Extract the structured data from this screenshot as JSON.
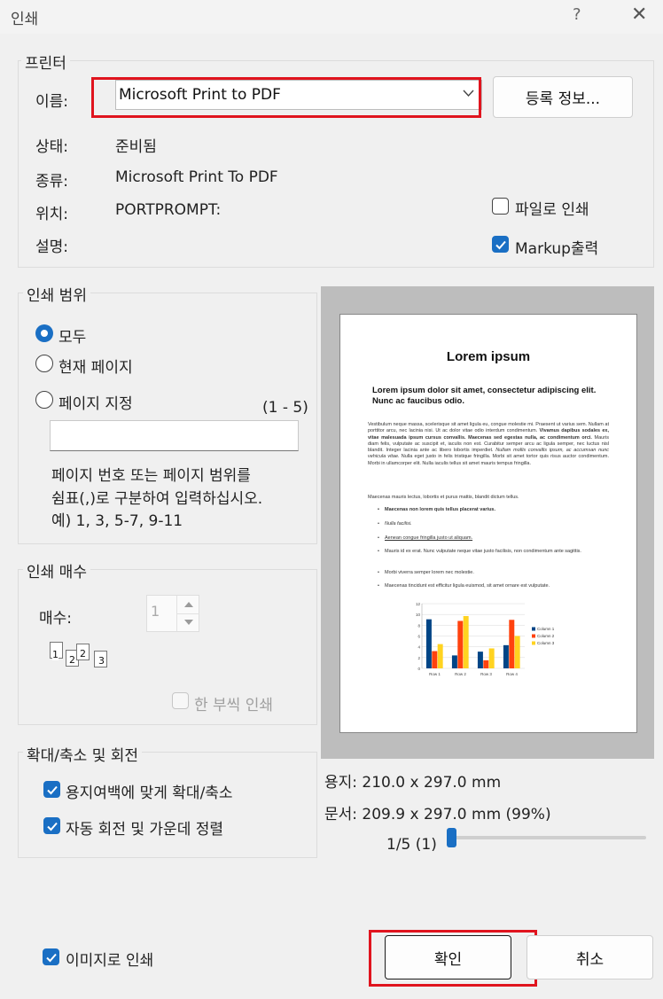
{
  "window": {
    "title": "인쇄",
    "help": "?",
    "close": "✕"
  },
  "printer": {
    "group_title": "프린터",
    "name_label": "이름:",
    "name_value": "Microsoft Print to PDF",
    "properties_button": "등록 정보...",
    "status_label": "상태:",
    "status_value": "준비됨",
    "type_label": "종류:",
    "type_value": "Microsoft Print To PDF",
    "where_label": "위치:",
    "where_value": "PORTPROMPT:",
    "comment_label": "설명:",
    "print_to_file": {
      "label": "파일로 인쇄",
      "checked": false
    },
    "markup_output": {
      "label": "Markup출력",
      "checked": true
    }
  },
  "range": {
    "group_title": "인쇄 범위",
    "options": [
      {
        "label": "모두",
        "selected": true
      },
      {
        "label": "현재 페이지",
        "selected": false
      },
      {
        "label": "페이지 지정",
        "selected": false
      }
    ],
    "page_count_hint": "(1 - 5)",
    "pages_input_value": "",
    "help_lines": [
      "페이지 번호 또는 페이지 범위를",
      "쉼표(,)로 구분하여 입력하십시오.",
      "예) 1, 3, 5-7, 9-11"
    ]
  },
  "copies": {
    "group_title": "인쇄 매수",
    "count_label": "매수:",
    "count_value": "1",
    "collate_digits": [
      "1",
      "2",
      "2",
      "3"
    ],
    "collate": {
      "label": "한 부씩 인쇄",
      "checked": false,
      "disabled": true
    }
  },
  "scaling": {
    "group_title": "확대/축소 및 회전",
    "fit_to_margins": {
      "label": "용지여백에 맞게 확대/축소",
      "checked": true
    },
    "auto_rotate_center": {
      "label": "자동 회전 및 가운데 정렬",
      "checked": true
    }
  },
  "preview": {
    "paper_size": "용지: 210.0 x 297.0 mm",
    "document_size": "문서: 209.9 x 297.0 mm (99%)",
    "page_indicator": "1/5 (1)",
    "slider_position": 0,
    "document": {
      "title": "Lorem ipsum",
      "subtitle": "Lorem ipsum dolor sit amet, consectetur adipiscing elit. Nunc ac faucibus odio.",
      "para1_a": "Vestibulum neque massa, scelerisque sit amet ligula eu, congue molestie mi. Praesent ut varius sem. Nullam at porttitor arcu, nec lacinia nisi. Ut ac dolor vitae odio interdum condimentum. ",
      "para1_b": "Vivamus dapibus sodales ex, vitae malesuada ipsum cursus convallis. Maecenas sed egestas nulla, ac condimentum orci.",
      "para1_c": " Mauris diam felis, vulputate ac suscipit et, iaculis non est. Curabitur semper arcu ac ligula semper, nec luctus nisl blandit. Integer lacinia ante ac libero lobortis imperdiet. ",
      "para1_d": "Nullam mollis convallis ipsum, ac accumsan nunc vehicula vitae.",
      "para1_e": " Nulla eget justo in felis tristique fringilla. Morbi sit amet tortor quis risus auctor condimentum. Morbi in ullamcorper elit. Nulla iaculis tellus sit amet mauris tempus fringilla.",
      "para2": "Maecenas mauris lectus, lobortis et purus mattis, blandit dictum tellus.",
      "bullets": [
        "Maecenas non lorem quis tellus placerat varius.",
        "Nulla facilisi.",
        "Aenean congue fringilla justo ut aliquam.",
        "Mauris id ex erat. Nunc vulputate neque vitae justo facilisis, non condimentum ante sagittis.",
        "Morbi viverra semper lorem nec molestie.",
        "Maecenas tincidunt est efficitur ligula euismod, sit amet ornare est vulputate."
      ]
    }
  },
  "chart_data": {
    "type": "bar",
    "categories": [
      "Row 1",
      "Row 2",
      "Row 3",
      "Row 4"
    ],
    "series": [
      {
        "name": "Column 1",
        "color": "#004586",
        "values": [
          9.1,
          2.4,
          3.1,
          4.3
        ]
      },
      {
        "name": "Column 2",
        "color": "#ff420e",
        "values": [
          3.2,
          8.8,
          1.5,
          9.0
        ]
      },
      {
        "name": "Column 3",
        "color": "#ffd320",
        "values": [
          4.5,
          9.7,
          3.7,
          6.0
        ]
      }
    ],
    "ylim": [
      0,
      12
    ],
    "yticks": [
      "0",
      "2",
      "4",
      "6",
      "8",
      "10",
      "12"
    ],
    "grid": true,
    "legend": "right"
  },
  "footer": {
    "print_as_image": {
      "label": "이미지로 인쇄",
      "checked": true
    },
    "ok": "확인",
    "cancel": "취소"
  },
  "colors": {
    "accent": "#1a6fc4",
    "highlight": "#e0141e"
  }
}
